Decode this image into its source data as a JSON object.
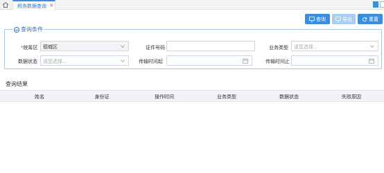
{
  "tabs": [
    {
      "label": "税务数据查询"
    }
  ],
  "toolbar": {
    "query_label": "查询",
    "export_label": "导出",
    "reset_label": "重置"
  },
  "query_conditions": {
    "title": "查询条件",
    "fields": {
      "district": {
        "label": "统筹区",
        "value": "德城区"
      },
      "cert_no": {
        "label": "证件号码",
        "value": ""
      },
      "biz_type": {
        "label": "业务类型",
        "placeholder": "请您选择..."
      },
      "data_status": {
        "label": "数据状态",
        "placeholder": "请您选择..."
      },
      "transfer_start": {
        "label": "传输时间起",
        "value": ""
      },
      "transfer_end": {
        "label": "传输时间止",
        "value": ""
      }
    }
  },
  "results": {
    "title": "查询结果",
    "columns": [
      "姓名",
      "身份证",
      "操作时间",
      "业务类型",
      "数据状态",
      "失败原因"
    ]
  },
  "colors": {
    "accent": "#3b8de0",
    "accent_disabled": "#a9cdf0",
    "border": "#a8c4e6"
  }
}
